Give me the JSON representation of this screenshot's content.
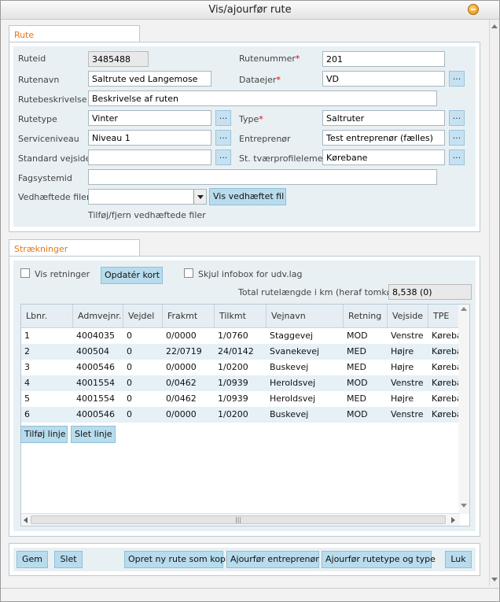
{
  "window": {
    "title": "Vis/ajourfør rute"
  },
  "rute": {
    "tab": "Rute",
    "fields": {
      "ruteid": {
        "label": "Ruteid",
        "value": "3485488"
      },
      "rutenummer": {
        "label": "Rutenummer",
        "value": "201"
      },
      "rutenavn": {
        "label": "Rutenavn",
        "value": "Saltrute ved Langemose"
      },
      "dataejer": {
        "label": "Dataejer",
        "value": "VD"
      },
      "rutebeskrivelse": {
        "label": "Rutebeskrivelse",
        "value": "Beskrivelse af ruten"
      },
      "rutetype": {
        "label": "Rutetype",
        "value": "Vinter"
      },
      "type": {
        "label": "Type",
        "value": "Saltruter"
      },
      "serviceniveau": {
        "label": "Serviceniveau",
        "value": "Niveau 1"
      },
      "entreprenor": {
        "label": "Entreprenør",
        "value": "Test entreprenør (fælles)"
      },
      "standard_vejside": {
        "label": "Standard vejside",
        "value": ""
      },
      "st_tvaerprofil": {
        "label": "St. tværprofilelement",
        "value": "Kørebane"
      },
      "fagsystemid": {
        "label": "Fagsystemid",
        "value": ""
      },
      "vedhaeftede": {
        "label": "Vedhæftede filer:",
        "value": ""
      }
    },
    "required_mark": "*",
    "dots": "...",
    "vis_vedhaeftet": "Vis vedhæftet fil",
    "tilfoj_fjern": "Tilføj/fjern vedhæftede filer"
  },
  "straekninger": {
    "tab": "Strækninger",
    "vis_retninger": "Vis retninger",
    "opdater_kort": "Opdatér kort",
    "skjul_infobox": "Skjul infobox for udv.lag",
    "total_label": "Total rutelængde i km (heraf tomkørsel)",
    "total_value": "8,538 (0)",
    "columns": [
      "Lbnr.",
      "Admvejnr.",
      "Vejdel",
      "Frakmt",
      "Tilkmt",
      "Vejnavn",
      "Retning",
      "Vejside",
      "TPE"
    ],
    "rows": [
      [
        "1",
        "4004035",
        "0",
        "0/0000",
        "1/0760",
        "Staggevej",
        "MOD",
        "Venstre",
        "Kørebane"
      ],
      [
        "2",
        "400504",
        "0",
        "22/0719",
        "24/0142",
        "Svanekevej",
        "MED",
        "Højre",
        "Kørebane"
      ],
      [
        "3",
        "4000546",
        "0",
        "0/0000",
        "1/0200",
        "Buskevej",
        "MED",
        "Højre",
        "Kørebane"
      ],
      [
        "4",
        "4001554",
        "0",
        "0/0462",
        "1/0939",
        "Heroldsvej",
        "MOD",
        "Venstre",
        "Kørebane"
      ],
      [
        "5",
        "4001554",
        "0",
        "0/0462",
        "1/0939",
        "Heroldsvej",
        "MED",
        "Højre",
        "Kørebane"
      ],
      [
        "6",
        "4000546",
        "0",
        "0/0000",
        "1/0200",
        "Buskevej",
        "MOD",
        "Venstre",
        "Kørebane"
      ]
    ],
    "tilfoj_linje": "Tilføj linje",
    "slet_linje": "Slet linje"
  },
  "footer": {
    "gem": "Gem",
    "slet": "Slet",
    "opret_kopi": "Opret ny rute som kopi",
    "ajourfor_entreprenor": "Ajourfør entreprenør",
    "ajourfor_rutetype": "Ajourfør rutetype og type",
    "luk": "Luk"
  },
  "colors": {
    "tab_text": "#e07818",
    "panel_bg": "#e8f0f4",
    "button_bg": "#b8dced",
    "row_alt": "#e6f0f7"
  }
}
